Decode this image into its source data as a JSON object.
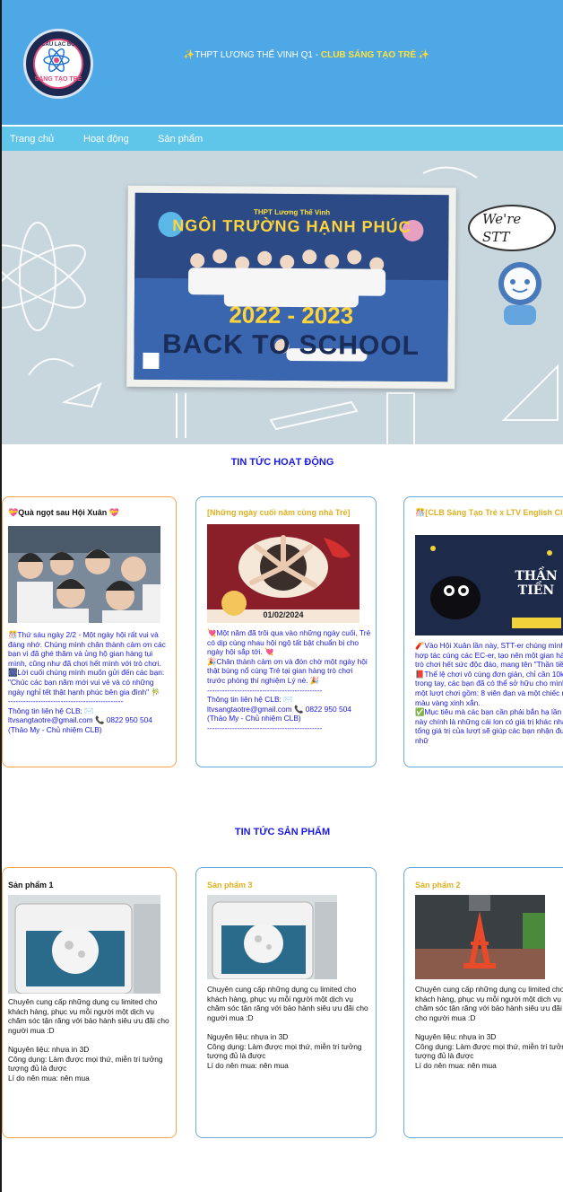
{
  "header": {
    "logo_top_text": "CÂU LẠC BỘ",
    "logo_bottom_text": "SÁNG TẠO TRẺ",
    "title_prefix": "✨THPT LƯƠNG THẾ VINH Q1 - ",
    "title_highlight": "CLUB SÁNG TẠO TRẺ",
    "title_suffix": " ✨"
  },
  "nav": {
    "items": [
      {
        "label": "Trang chủ"
      },
      {
        "label": "Hoạt động"
      },
      {
        "label": "Sản phẩm"
      }
    ]
  },
  "hero": {
    "banner_top": "THPT Lương Thế Vinh",
    "banner_main": "NGÔI TRƯỜNG HẠNH PHÚC",
    "banner_year": "2022 - 2023",
    "banner_bts": "BACK TO SCHOOL",
    "speech": "We're STT"
  },
  "news": {
    "title": "TIN TỨC HOẠT ĐỘNG",
    "cards": [
      {
        "heading": "💝Quà ngọt sau Hội Xuân 💝",
        "body": "🎊Thứ sáu ngày 2/2 - Một ngày hội rất vui và đáng nhớ. Chúng mình chân thành cảm ơn các bạn vì đã ghé thăm và ủng hộ gian hàng tụi mình, cũng như đã chơi hết mình với trò chơi.\n🎆Lời cuối chúng mình muốn gửi đến các bạn: \"Chúc các bạn năm mới vui vẻ và có những ngày nghỉ tết thật hạnh phúc bên gia đình\" 🎋\n----------------------------------------------\nThông tin liên hệ CLB: ✉️\nltvsangtaotre@gmail.com 📞 0822 950 504\n(Thảo My - Chủ nhiệm CLB)"
      },
      {
        "heading": "[Những ngày cuối năm cùng nhà Trẻ]",
        "image_caption": "01/02/2024",
        "body": "💘Một năm đã trôi qua vào những ngày cuối, Trẻ có dịp cùng nhau hội ngộ tất bật chuẩn bị cho ngày hội sắp tới. 💘\n🎉Chân thành cảm ơn và đón chờ một ngày hội thật bùng nổ cùng Trẻ tại gian hàng trò chơi trước phòng thí nghiệm Lý nè. 🎉\n----------------------------------------------\nThông tin liên hệ CLB: ✉️\nltvsangtaotre@gmail.com 📞 0822 950 504\n(Thảo My - Chủ nhiệm CLB)\n----------------------------------------------"
      },
      {
        "heading": "🎊[CLB Sáng Tạo Trẻ x LTV English Club]",
        "image_title": "THẦN TIỀN",
        "body": "🧨Vào Hội Xuân lần này, STT-er chúng mình hợp tác cùng các EC-er, tạo nên một gian hàng trò chơi hết sức độc đáo, mang tên \"Thần tiền\".\n📕Thể lệ chơi vô cùng đơn giản, chỉ cần 10k trong tay, các bạn đã có thể sở hữu cho mình một lượt chơi gồm: 8 viên đạn và một chiếc ná màu vàng xinh xắn.\n✅Mục tiêu mà các bạn cần phải bắn hạ lần này chính là những cái lon có giá trị khác nhau, tổng giá trị của lượt sẽ giúp các bạn nhận được nhữ"
      }
    ]
  },
  "products": {
    "title": "TIN TỨC SẢN PHẨM",
    "cards": [
      {
        "heading": "Sản phẩm 1",
        "body": "Chuyên cung cấp những dụng cụ limited cho khách hàng, phục vụ mỗi người một dịch vụ chăm sóc tận răng với bảo hành siêu ưu đãi cho người mua :D\n\nNguyên liệu: nhựa in 3D\nCông dụng: Làm được mọi thứ, miễn trí tưởng tượng đủ là được\nLí do nên mua: nên mua"
      },
      {
        "heading": "Sản phẩm 3",
        "body": "Chuyên cung cấp những dụng cụ limited cho khách hàng, phục vụ mỗi người một dịch vụ chăm sóc tận răng với bảo hành siêu ưu đãi cho người mua :D\n\nNguyên liệu: nhựa in 3D\nCông dụng: Làm được mọi thứ, miễn trí tưởng tượng đủ là được\nLí do nên mua: nên mua"
      },
      {
        "heading": "Sản phẩm 2",
        "body": "Chuyên cung cấp những dụng cụ limited cho khách hàng, phục vụ mỗi người một dịch vụ chăm sóc tận răng với bảo hành siêu ưu đãi cho người mua :D\n\nNguyên liệu: nhựa in 3D\nCông dụng: Làm được mọi thứ, miễn trí tưởng tượng đủ là được\nLí do nên mua: nên mua"
      }
    ]
  },
  "colors": {
    "header_bg": "#4ea8e6",
    "nav_bg": "#5fc6ea",
    "highlight": "#ffe23a",
    "section_title": "#1a1ae0",
    "card_orange": "#f2a54a",
    "card_blue": "#6aa6d8",
    "card_yellow_heading": "#e0b020"
  }
}
